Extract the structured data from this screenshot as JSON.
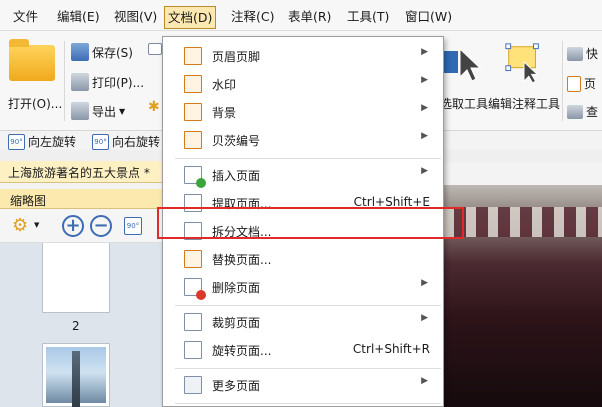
{
  "menubar": {
    "items": [
      "文件",
      "编辑(E)",
      "视图(V)",
      "文档(D)",
      "注释(C)",
      "表单(R)",
      "工具(T)",
      "窗口(W)"
    ],
    "active_index": 3
  },
  "toolbar": {
    "open_label": "打开(O)...",
    "save_label": "保存(S)",
    "print_label": "打印(P)...",
    "export_label": "导出",
    "rotate_left_label": "向左旋转",
    "rotate_right_label": "向右旋转",
    "select_tool_label": "选取工具",
    "edit_annotation_label": "编辑注释工具",
    "right_cut_1": "快",
    "right_cut_2": "页",
    "right_cut_3": "查"
  },
  "document_tab": {
    "title": "上海旅游著名的五大景点 *"
  },
  "thumbnail_panel": {
    "title": "缩略图",
    "page_number": "2"
  },
  "document_menu": {
    "items": [
      {
        "label": "页眉页脚",
        "shortcut": "",
        "submenu": true
      },
      {
        "label": "水印",
        "shortcut": "",
        "submenu": true
      },
      {
        "label": "背景",
        "shortcut": "",
        "submenu": true
      },
      {
        "label": "贝茨编号",
        "shortcut": "",
        "submenu": true
      },
      {
        "label": "插入页面",
        "shortcut": "",
        "submenu": true
      },
      {
        "label": "提取页面...",
        "shortcut": "Ctrl+Shift+E",
        "submenu": false
      },
      {
        "label": "拆分文档...",
        "shortcut": "",
        "submenu": false
      },
      {
        "label": "替换页面...",
        "shortcut": "",
        "submenu": false
      },
      {
        "label": "删除页面",
        "shortcut": "",
        "submenu": true
      },
      {
        "label": "裁剪页面",
        "shortcut": "",
        "submenu": true
      },
      {
        "label": "旋转页面...",
        "shortcut": "Ctrl+Shift+R",
        "submenu": false
      },
      {
        "label": "更多页面",
        "shortcut": "",
        "submenu": true
      }
    ],
    "highlighted_index": 6
  },
  "colors": {
    "accent": "#fce8b0",
    "highlight_box": "#e02a2a"
  }
}
